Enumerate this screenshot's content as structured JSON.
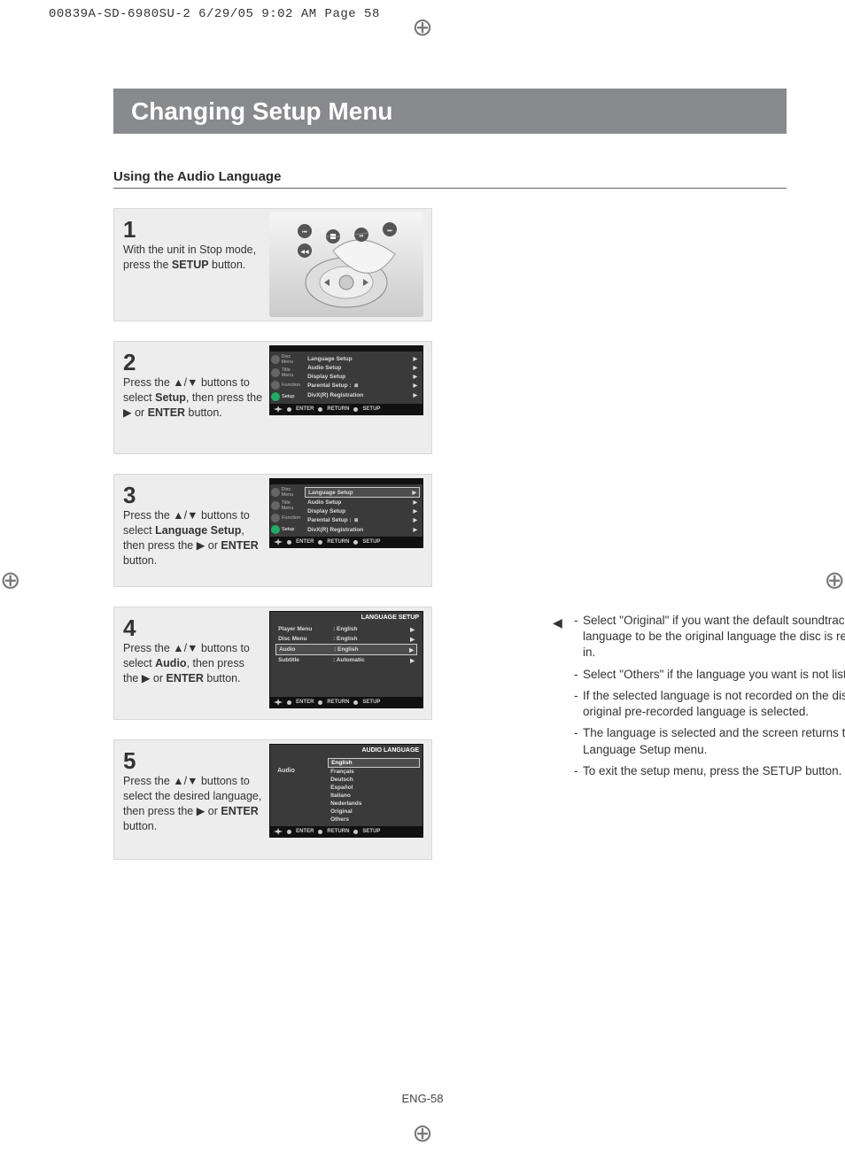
{
  "header_line": "00839A-SD-6980SU-2  6/29/05  9:02 AM  Page 58",
  "title": "Changing Setup Menu",
  "subtitle": "Using the Audio Language",
  "steps": [
    {
      "num": "1",
      "text_parts": [
        "With the unit in Stop mode, press the ",
        "SETUP",
        " button."
      ]
    },
    {
      "num": "2",
      "text_parts": [
        "Press the ▲/▼ buttons to select ",
        "Setup",
        ", then press the ▶ or ",
        "ENTER",
        " button."
      ]
    },
    {
      "num": "3",
      "text_parts": [
        "Press the ▲/▼ buttons to select ",
        "Language Setup",
        ", then press the ▶ or ",
        "ENTER",
        " button."
      ]
    },
    {
      "num": "4",
      "text_parts": [
        "Press the ▲/▼ buttons to select ",
        "Audio",
        ", then press the ▶ or ",
        "ENTER",
        " button."
      ]
    },
    {
      "num": "5",
      "text_parts": [
        "Press the ▲/▼ buttons to select the desired language, then press the ▶ or ",
        "ENTER",
        " button."
      ]
    }
  ],
  "osd_side": [
    {
      "icon": "disc",
      "label": "Disc Menu"
    },
    {
      "icon": "title",
      "label": "Title Menu"
    },
    {
      "icon": "func",
      "label": "Function"
    },
    {
      "icon": "setup",
      "label": "Setup"
    }
  ],
  "osd_main_items": [
    "Language Setup",
    "Audio Setup",
    "Display Setup",
    "Parental Setup :",
    "DivX(R) Registration"
  ],
  "osd_foot": {
    "enter": "ENTER",
    "return": "RETURN",
    "setup": "SETUP"
  },
  "lang_setup": {
    "title": "LANGUAGE SETUP",
    "rows": [
      {
        "k": "Player Menu",
        "v": ": English"
      },
      {
        "k": "Disc Menu",
        "v": ": English"
      },
      {
        "k": "Audio",
        "v": ": English"
      },
      {
        "k": "Subtitle",
        "v": ": Automatic"
      }
    ]
  },
  "audio_lang": {
    "title": "AUDIO LANGUAGE",
    "side_label": "Audio",
    "options": [
      "English",
      "Français",
      "Deutsch",
      "Español",
      "Italiano",
      "Nederlands",
      "Original",
      "Others"
    ]
  },
  "notes": [
    "Select \"Original\" if you want the default soundtrack language to be the original language the disc is recorded in.",
    "Select \"Others\" if the language you want is not  listed.",
    "If the selected language is not recorded on the disc, the original pre-recorded language is selected.",
    "The language is selected and the screen returns to Language Setup menu.",
    "To exit the setup menu, press the SETUP button."
  ],
  "page_footer": "ENG-58"
}
